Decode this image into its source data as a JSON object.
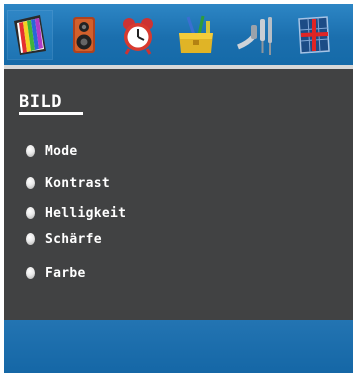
{
  "menu": {
    "title": "BILD",
    "items": [
      {
        "label": "Mode"
      },
      {
        "label": "Kontrast"
      },
      {
        "label": "Helligkeit"
      },
      {
        "label": "Schärfe"
      },
      {
        "label": "Farbe"
      }
    ]
  },
  "iconbar": {
    "tabs": [
      {
        "icon": "picture-icon",
        "selected": true
      },
      {
        "icon": "speaker-icon",
        "selected": false
      },
      {
        "icon": "clock-icon",
        "selected": false
      },
      {
        "icon": "toolbox-icon",
        "selected": false
      },
      {
        "icon": "connector-cables-icon",
        "selected": false
      },
      {
        "icon": "channel-grid-icon",
        "selected": false
      }
    ]
  },
  "colors": {
    "osd_background": "#414243",
    "bar_blue": "#1b6fae",
    "text": "#ffffff"
  }
}
